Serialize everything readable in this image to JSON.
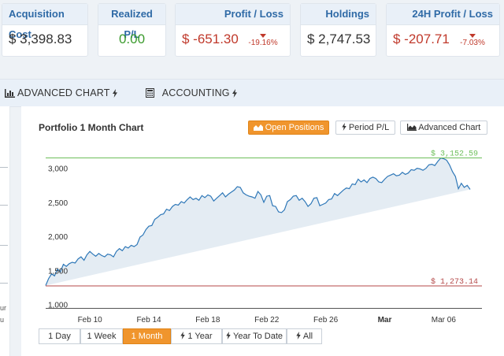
{
  "cards": {
    "acquisition": {
      "label": "Acquisition Cost",
      "value": "$ 3,398.83"
    },
    "realized": {
      "label": "Realized P/L",
      "value": "0.00"
    },
    "profit": {
      "label": "Profit / Loss",
      "value": "$ -651.30",
      "pct": "-19.16%"
    },
    "holdings": {
      "label": "Holdings",
      "value": "$ 2,747.53"
    },
    "daily": {
      "label": "24H Profit / Loss",
      "value": "$ -207.71",
      "pct": "-7.03%"
    }
  },
  "tabs": {
    "advanced": {
      "label": "ADVANCED CHART",
      "icon": "bar-chart-icon"
    },
    "accounting": {
      "label": "ACCOUNTING",
      "icon": "calculator-icon"
    }
  },
  "left_strip": {
    "frag1": "ur",
    "frag2": "u"
  },
  "chart_panel": {
    "title": "Portfolio 1 Month Chart",
    "buttons": {
      "open_positions": "Open Positions",
      "period_pl": "Period P/L",
      "advanced_chart": "Advanced Chart"
    },
    "ranges": [
      "1 Day",
      "1 Week",
      "1 Month",
      "1 Year",
      "Year To Date",
      "All"
    ],
    "active_range": "1 Month"
  },
  "colors": {
    "accent": "#f0952d",
    "line": "#2f78b8",
    "area": "#e4ecf3",
    "max_line": "#6dbf5a",
    "min_line": "#b54a4a"
  },
  "chart_data": {
    "type": "area",
    "title": "Portfolio 1 Month Chart",
    "xlabel": "",
    "ylabel": "",
    "ylim": [
      950,
      3100
    ],
    "yticks": [
      1000,
      1500,
      2000,
      2500,
      3000
    ],
    "ytick_labels": [
      "1,000",
      "1,500",
      "2,000",
      "2,500",
      "3,000"
    ],
    "xticks": [
      {
        "day": 3,
        "label": "Feb 10",
        "bold": false
      },
      {
        "day": 7,
        "label": "Feb 14",
        "bold": false
      },
      {
        "day": 11,
        "label": "Feb 18",
        "bold": false
      },
      {
        "day": 15,
        "label": "Feb 22",
        "bold": false
      },
      {
        "day": 19,
        "label": "Feb 26",
        "bold": false
      },
      {
        "day": 23,
        "label": "Mar",
        "bold": true
      },
      {
        "day": 27,
        "label": "Mar 06",
        "bold": false
      }
    ],
    "max_label": "$ 3,152.59",
    "max_value": 3152.59,
    "min_label": "$ 1,273.14",
    "min_value": 1273.14,
    "x_days": [
      0,
      0.2,
      0.4,
      0.6,
      0.8,
      1.0,
      1.2,
      1.4,
      1.6,
      1.8,
      2.0,
      2.2,
      2.4,
      2.6,
      2.8,
      3.0,
      3.2,
      3.4,
      3.6,
      3.8,
      4.0,
      4.2,
      4.4,
      4.6,
      4.8,
      5.0,
      5.2,
      5.4,
      5.6,
      5.8,
      6.0,
      6.2,
      6.4,
      6.6,
      6.8,
      7.0,
      7.2,
      7.4,
      7.6,
      7.8,
      8.0,
      8.2,
      8.4,
      8.6,
      8.8,
      9.0,
      9.2,
      9.4,
      9.6,
      9.8,
      10.0,
      10.2,
      10.4,
      10.6,
      10.8,
      11.0,
      11.2,
      11.4,
      11.6,
      11.8,
      12.0,
      12.2,
      12.4,
      12.6,
      12.8,
      13.0,
      13.2,
      13.4,
      13.6,
      13.8,
      14.0,
      14.2,
      14.4,
      14.6,
      14.8,
      15.0,
      15.2,
      15.4,
      15.6,
      15.8,
      16.0,
      16.2,
      16.4,
      16.6,
      16.8,
      17.0,
      17.2,
      17.4,
      17.6,
      17.8,
      18.0,
      18.2,
      18.4,
      18.6,
      18.8,
      19.0,
      19.2,
      19.4,
      19.6,
      19.8,
      20.0,
      20.2,
      20.4,
      20.6,
      20.8,
      21.0,
      21.2,
      21.4,
      21.6,
      21.8,
      22.0,
      22.2,
      22.4,
      22.6,
      22.8,
      23.0,
      23.2,
      23.4,
      23.6,
      23.8,
      24.0,
      24.2,
      24.4,
      24.6,
      24.8,
      25.0,
      25.2,
      25.4,
      25.6,
      25.8,
      26.0,
      26.2,
      26.4,
      26.6,
      26.8,
      27.0,
      27.2,
      27.4,
      27.6,
      27.8,
      28.0,
      28.2,
      28.4,
      28.6,
      28.8,
      29.0,
      29.2,
      29.4,
      29.6
    ],
    "values": [
      1280,
      1380,
      1450,
      1420,
      1520,
      1480,
      1590,
      1560,
      1600,
      1620,
      1610,
      1670,
      1700,
      1650,
      1730,
      1780,
      1740,
      1710,
      1750,
      1720,
      1700,
      1740,
      1730,
      1700,
      1780,
      1820,
      1790,
      1850,
      1830,
      1870,
      1850,
      1880,
      1990,
      2020,
      2100,
      2150,
      2160,
      2250,
      2280,
      2320,
      2330,
      2400,
      2380,
      2440,
      2470,
      2460,
      2510,
      2490,
      2540,
      2580,
      2540,
      2560,
      2530,
      2600,
      2570,
      2610,
      2590,
      2520,
      2560,
      2600,
      2640,
      2580,
      2620,
      2650,
      2680,
      2730,
      2720,
      2640,
      2610,
      2590,
      2580,
      2560,
      2660,
      2610,
      2500,
      2590,
      2600,
      2450,
      2440,
      2360,
      2350,
      2390,
      2510,
      2540,
      2590,
      2600,
      2530,
      2560,
      2510,
      2440,
      2480,
      2560,
      2570,
      2450,
      2470,
      2490,
      2540,
      2550,
      2630,
      2600,
      2640,
      2680,
      2710,
      2700,
      2770,
      2760,
      2840,
      2800,
      2830,
      2790,
      2850,
      2870,
      2850,
      2800,
      2790,
      2840,
      2880,
      2900,
      2920,
      2890,
      2900,
      2940,
      2910,
      2930,
      2980,
      2970,
      3000,
      2990,
      2970,
      3000,
      3050,
      3060,
      3040,
      3100,
      3150,
      3140,
      3120,
      3050,
      2950,
      2880,
      2700,
      2780,
      2720,
      2750,
      2690
    ]
  }
}
